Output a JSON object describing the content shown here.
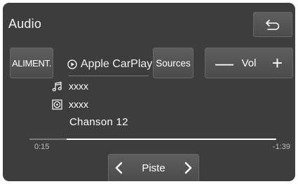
{
  "header": {
    "title": "Audio",
    "back_icon": "back-arrow-icon"
  },
  "controls": {
    "aliment_label": "ALIMENT.",
    "source_icon": "play-circle-icon",
    "source_name": "Apple CarPlay",
    "sources_label": "Sources",
    "volume": {
      "minus_glyph": "—",
      "label": "Vol",
      "plus_glyph": "+"
    }
  },
  "now_playing": {
    "artist_icon": "music-note-icon",
    "artist": "xxxx",
    "album_icon": "album-disc-icon",
    "album": "xxxx",
    "track": "Chanson 12"
  },
  "progress": {
    "elapsed": "0:15",
    "remaining": "-1:39",
    "played_fraction": 0.15
  },
  "track_nav": {
    "label": "Piste",
    "prev_icon": "chevron-left-icon",
    "next_icon": "chevron-right-icon"
  },
  "colors": {
    "screen_background": "#3d3d3d",
    "button_background": "#555555",
    "text": "#ffffff"
  }
}
